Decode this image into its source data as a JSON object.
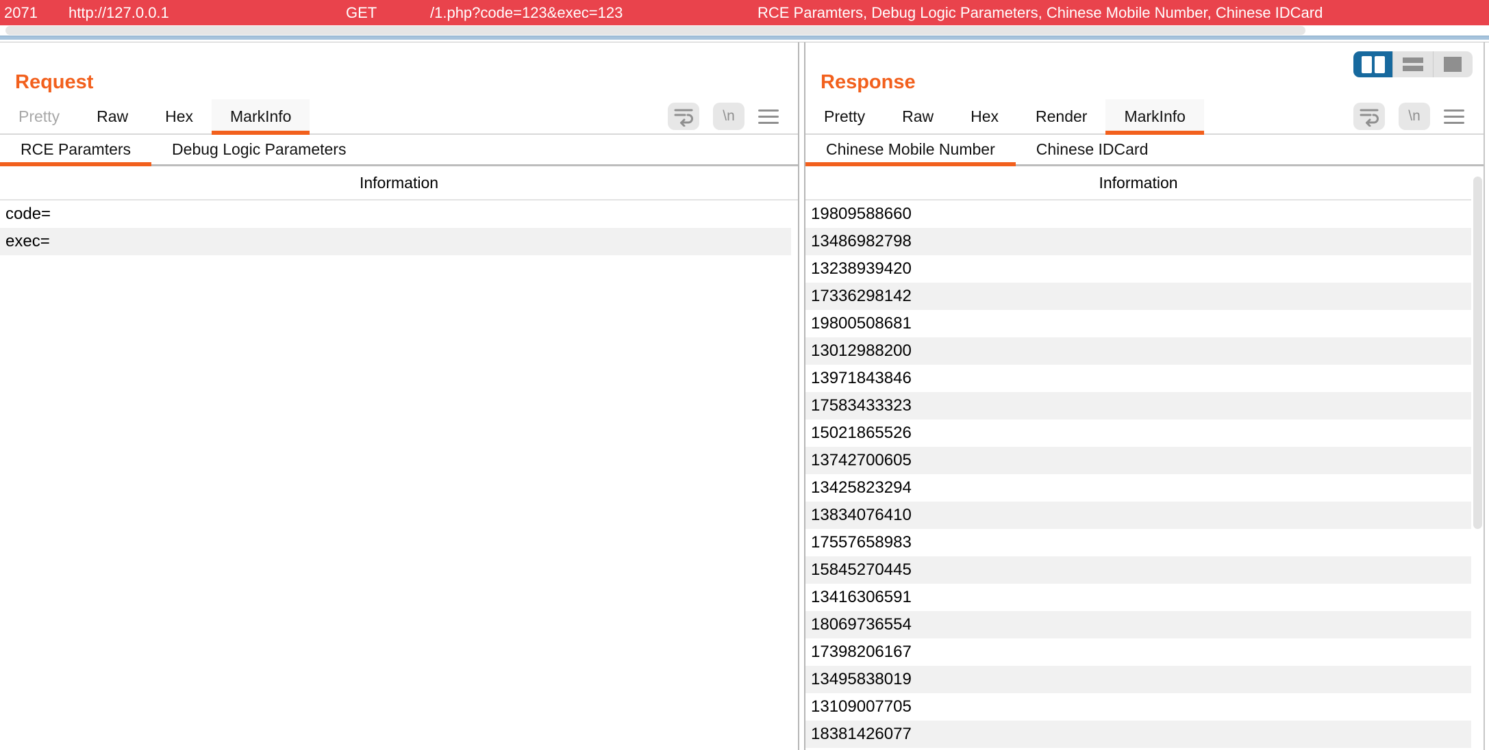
{
  "proxy_row": {
    "id": "2071",
    "url": "http://127.0.0.1",
    "method": "GET",
    "path": "/1.php?code=123&exec=123",
    "marks": "RCE Paramters, Debug Logic Parameters, Chinese Mobile Number, Chinese IDCard"
  },
  "request": {
    "title": "Request",
    "tabs": [
      "Pretty",
      "Raw",
      "Hex",
      "MarkInfo"
    ],
    "selected_tab": "MarkInfo",
    "subtabs": [
      "RCE Paramters",
      "Debug Logic Parameters"
    ],
    "selected_subtab": "RCE Paramters",
    "column_header": "Information",
    "rows": [
      "code=",
      "exec="
    ]
  },
  "response": {
    "title": "Response",
    "tabs": [
      "Pretty",
      "Raw",
      "Hex",
      "Render",
      "MarkInfo"
    ],
    "selected_tab": "MarkInfo",
    "subtabs": [
      "Chinese Mobile Number",
      "Chinese IDCard"
    ],
    "selected_subtab": "Chinese Mobile Number",
    "column_header": "Information",
    "rows": [
      "19809588660",
      "13486982798",
      "13238939420",
      "17336298142",
      "19800508681",
      "13012988200",
      "13971843846",
      "17583433323",
      "15021865526",
      "13742700605",
      "13425823294",
      "13834076410",
      "17557658983",
      "15845270445",
      "13416306591",
      "18069736554",
      "17398206167",
      "13495838019",
      "13109007705",
      "18381426077"
    ]
  },
  "editor_icons": {
    "newline_label": "\\n"
  },
  "colors": {
    "accent_orange": "#f2601d",
    "history_red": "#e9434c",
    "selected_layout_blue": "#17699e"
  }
}
